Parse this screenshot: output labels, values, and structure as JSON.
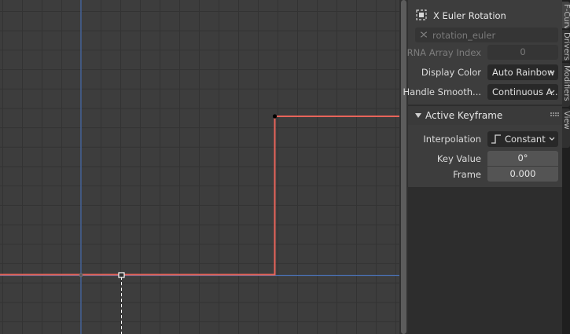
{
  "fcurve_panel": {
    "channel_name": "X Euler Rotation",
    "data_path": "rotation_euler",
    "rna_array_index_label": "RNA Array Index",
    "rna_array_index_value": "0",
    "display_color_label": "Display Color",
    "display_color_value": "Auto Rainbow",
    "handle_smoothing_label": "Handle Smooth...",
    "handle_smoothing_value": "Continuous A..."
  },
  "active_keyframe_panel": {
    "title": "Active Keyframe",
    "interpolation_label": "Interpolation",
    "interpolation_value": "Constant",
    "key_value_label": "Key Value",
    "key_value": "0°",
    "frame_label": "Frame",
    "frame_value": "0.000"
  },
  "sidebar_tabs": [
    "F-Curve",
    "Drivers",
    "Modifiers",
    "View"
  ],
  "colors": {
    "curve": "#e8645a",
    "x_axis_line": "#4a6fb0",
    "frame_cursor": "#ffffff",
    "keyframe_point": "#000000"
  },
  "icons": {
    "channel": "fcurve-channel-icon",
    "data_path": "rna-path-icon",
    "interpolation": "constant-interpolation-icon"
  }
}
